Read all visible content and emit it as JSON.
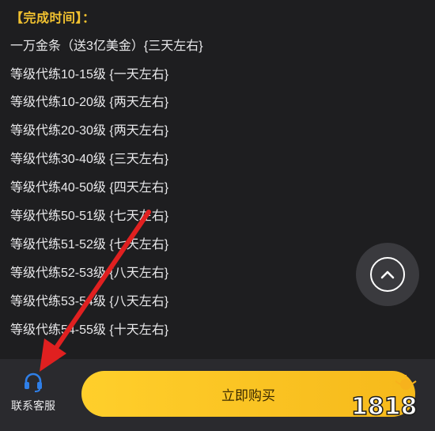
{
  "section_title": "【完成时间】：",
  "items": [
    "一万金条（送3亿美金）{三天左右}",
    "等级代练10-15级 {一天左右}",
    "等级代练10-20级 {两天左右}",
    "等级代练20-30级 {两天左右}",
    "等级代练30-40级 {三天左右}",
    "等级代练40-50级 {四天左右}",
    "等级代练50-51级 {七天左右}",
    "等级代练51-52级 {七天左右}",
    "等级代练52-53级 {八天左右}",
    "等级代练53-54级 {八天左右}",
    "等级代练54-55级 {十天左右}"
  ],
  "bottom_bar": {
    "service_label": "联系客服",
    "buy_label": "立即购买"
  },
  "icons": {
    "scroll_top": "chevron-up-icon",
    "service": "headset-icon",
    "watermark": "logo-1818"
  },
  "colors": {
    "title": "#f2c230",
    "button": "#ffcf2b",
    "arrow": "#e02020",
    "service_icon": "#2f7fe8"
  },
  "watermark": "1818"
}
